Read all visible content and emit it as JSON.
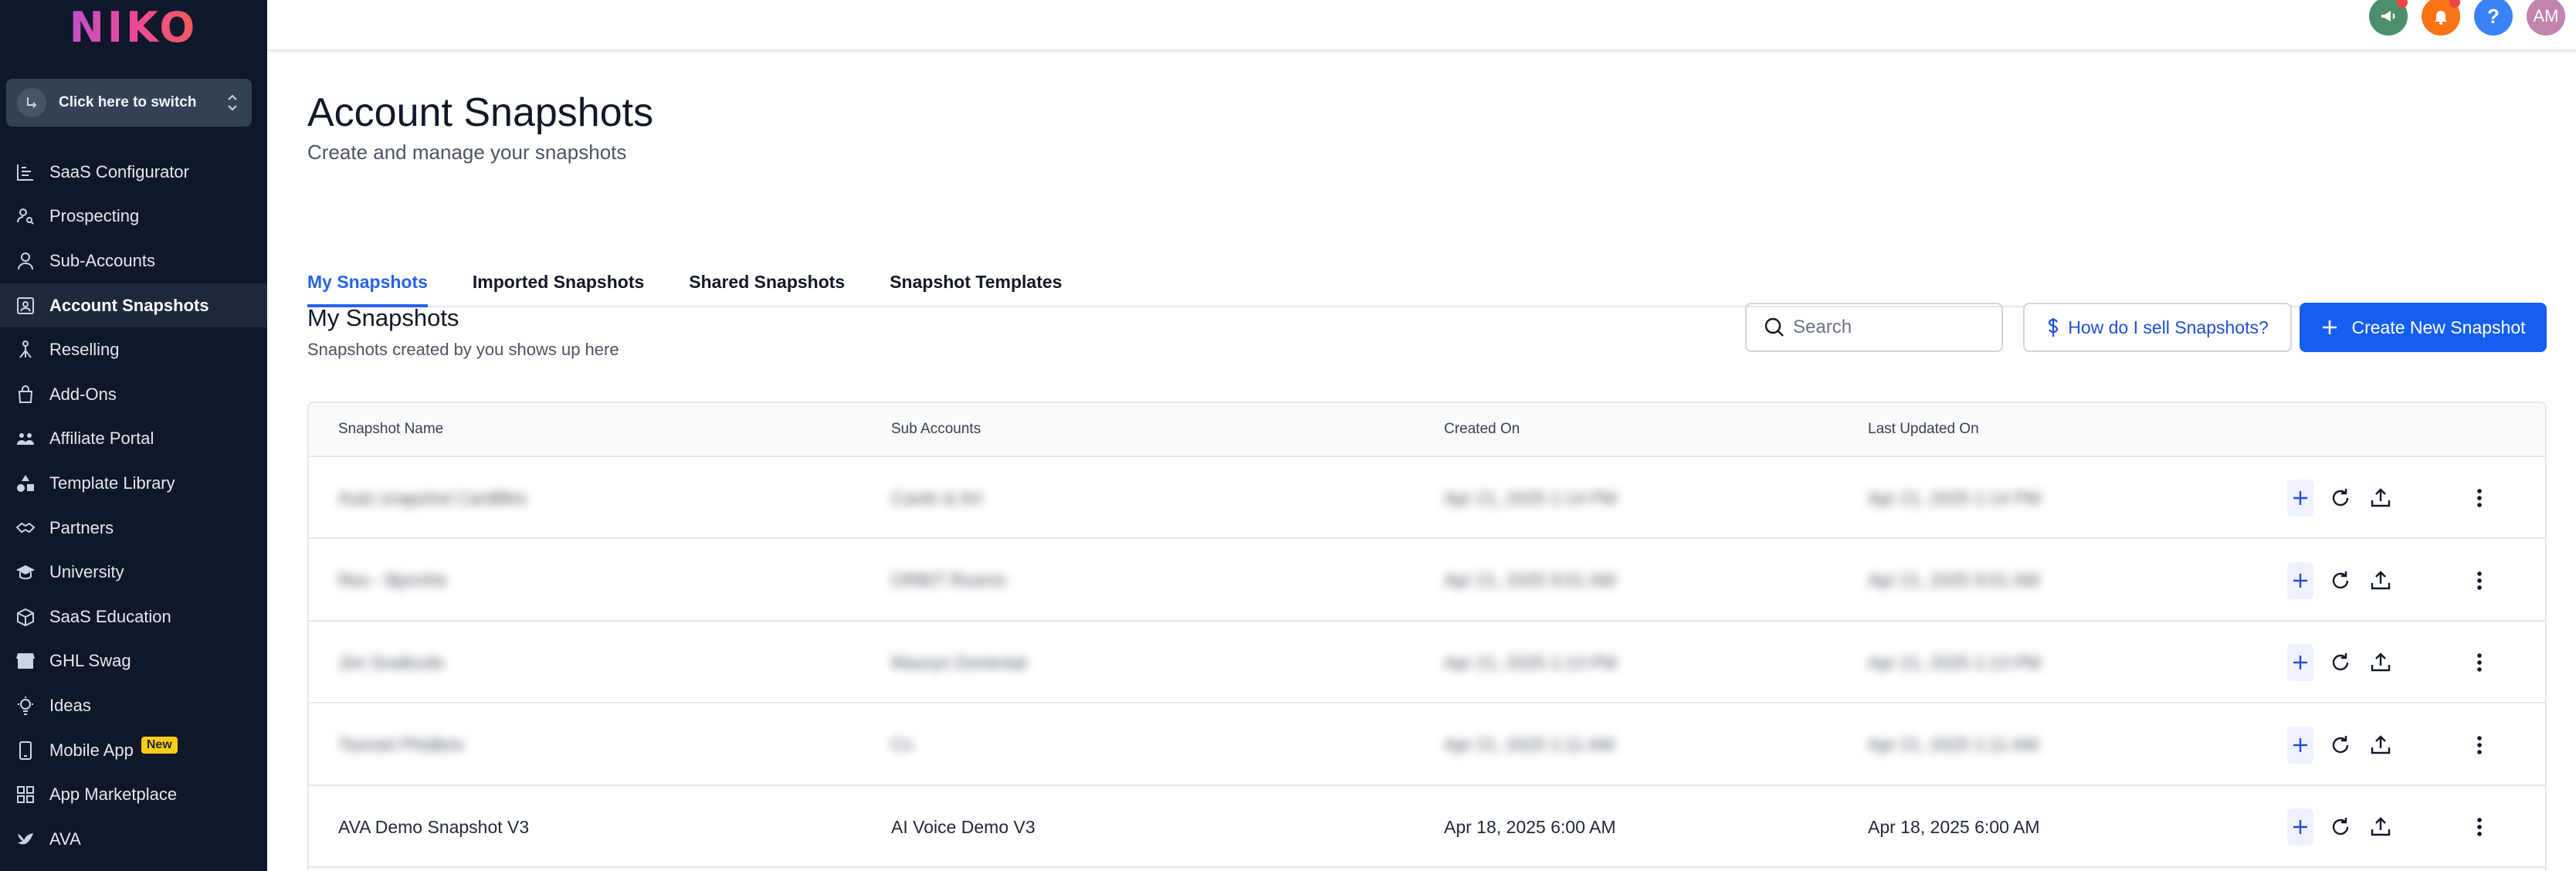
{
  "brand": {
    "logo_text": "NIKO"
  },
  "switcher": {
    "label": "Click here to switch"
  },
  "sidebar": {
    "items": [
      {
        "label": "SaaS Configurator",
        "icon": "chart-bars-icon",
        "active": false
      },
      {
        "label": "Prospecting",
        "icon": "user-search-icon",
        "active": false
      },
      {
        "label": "Sub-Accounts",
        "icon": "user-icon",
        "active": false
      },
      {
        "label": "Account Snapshots",
        "icon": "snapshot-icon",
        "active": true
      },
      {
        "label": "Reselling",
        "icon": "network-icon",
        "active": false
      },
      {
        "label": "Add-Ons",
        "icon": "shopping-bag-icon",
        "active": false
      },
      {
        "label": "Affiliate Portal",
        "icon": "users-icon",
        "active": false
      },
      {
        "label": "Template Library",
        "icon": "shapes-icon",
        "active": false
      },
      {
        "label": "Partners",
        "icon": "handshake-icon",
        "active": false
      },
      {
        "label": "University",
        "icon": "graduation-cap-icon",
        "active": false
      },
      {
        "label": "SaaS Education",
        "icon": "box-icon",
        "active": false
      },
      {
        "label": "GHL Swag",
        "icon": "store-icon",
        "active": false
      },
      {
        "label": "Ideas",
        "icon": "lightbulb-icon",
        "active": false
      },
      {
        "label": "Mobile App",
        "icon": "mobile-icon",
        "active": false,
        "badge": "New"
      },
      {
        "label": "App Marketplace",
        "icon": "grid-icon",
        "active": false
      },
      {
        "label": "AVA",
        "icon": "bird-icon",
        "active": false
      }
    ]
  },
  "header": {
    "actions": [
      {
        "name": "announcements-button",
        "icon": "megaphone-icon",
        "color": "#4b8f6b",
        "text": "",
        "dot": true
      },
      {
        "name": "notifications-button",
        "icon": "bell-icon",
        "color": "#f97316",
        "text": "",
        "dot": true
      },
      {
        "name": "help-button",
        "icon": "question-icon",
        "color": "#3b82f6",
        "text": "?",
        "dot": false
      },
      {
        "name": "avatar",
        "icon": "avatar",
        "color": "#c084ad",
        "text": "AM",
        "dot": false
      }
    ]
  },
  "page": {
    "title": "Account Snapshots",
    "subtitle": "Create and manage your snapshots"
  },
  "tabs": [
    {
      "label": "My Snapshots",
      "active": true
    },
    {
      "label": "Imported Snapshots",
      "active": false
    },
    {
      "label": "Shared Snapshots",
      "active": false
    },
    {
      "label": "Snapshot Templates",
      "active": false
    }
  ],
  "section": {
    "title": "My Snapshots",
    "subtitle": "Snapshots created by you shows up here"
  },
  "search": {
    "placeholder": "Search",
    "value": ""
  },
  "help_link": {
    "label": "How do I sell Snapshots?"
  },
  "create_button": {
    "label": "Create New Snapshot"
  },
  "table": {
    "columns": [
      "Snapshot Name",
      "Sub Accounts",
      "Created On",
      "Last Updated On"
    ],
    "rows": [
      {
        "name": "Auto snapshot Cardlifes",
        "sub_account": "Cards & Art",
        "created": "Apr 21, 2025 1:14 PM",
        "updated": "Apr 21, 2025 1:14 PM",
        "blurred": true
      },
      {
        "name": "Rex - Bjornhe",
        "sub_account": "ORBIT Rooms",
        "created": "Apr 21, 2025 9:01 AM",
        "updated": "Apr 21, 2025 9:01 AM",
        "blurred": true
      },
      {
        "name": "Jim Snaltcole",
        "sub_account": "Mauryn Doriental",
        "created": "Apr 21, 2025 1:13 PM",
        "updated": "Apr 21, 2025 1:13 PM",
        "blurred": true
      },
      {
        "name": "Tsorset Phidbriv",
        "sub_account": "Cx",
        "created": "Apr 21, 2025 1:11 AM",
        "updated": "Apr 21, 2025 1:11 AM",
        "blurred": true
      },
      {
        "name": "AVA Demo Snapshot V3",
        "sub_account": "AI Voice Demo V3",
        "created": "Apr 18, 2025 6:00 AM",
        "updated": "Apr 18, 2025 6:00 AM",
        "blurred": false
      }
    ]
  },
  "colors": {
    "sidebar_bg": "#0f172a",
    "accent": "#155eef",
    "tab_active": "#2563eb",
    "badge": "#facc15"
  }
}
